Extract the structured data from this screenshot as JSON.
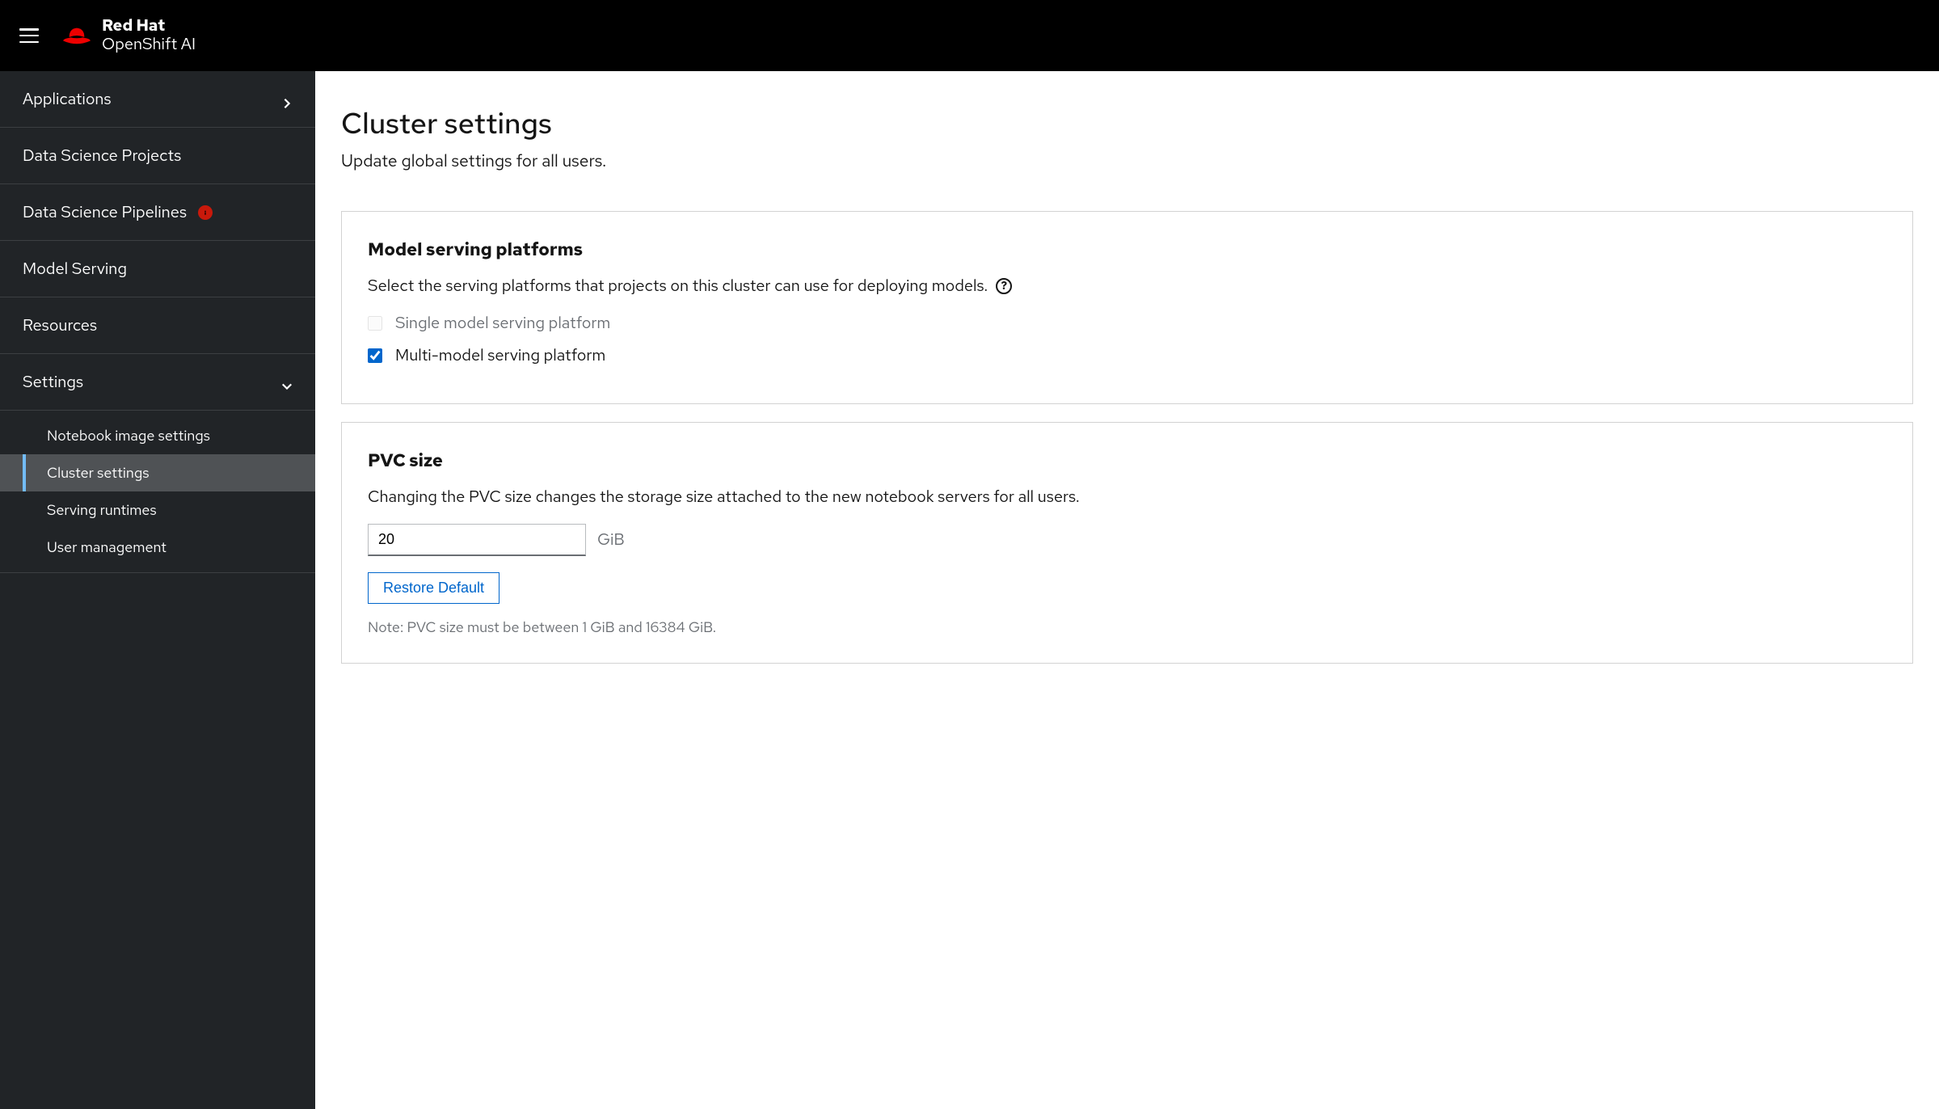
{
  "header": {
    "brand": "Red Hat",
    "product": "OpenShift AI"
  },
  "sidebar": {
    "items": [
      {
        "label": "Applications",
        "expandable": true,
        "expanded": false
      },
      {
        "label": "Data Science Projects"
      },
      {
        "label": "Data Science Pipelines",
        "alert": true
      },
      {
        "label": "Model Serving"
      },
      {
        "label": "Resources"
      },
      {
        "label": "Settings",
        "expandable": true,
        "expanded": true
      }
    ],
    "settings_sub": [
      {
        "label": "Notebook image settings"
      },
      {
        "label": "Cluster settings",
        "active": true
      },
      {
        "label": "Serving runtimes"
      },
      {
        "label": "User management"
      }
    ]
  },
  "page": {
    "title": "Cluster settings",
    "subtitle": "Update global settings for all users."
  },
  "model_serving": {
    "heading": "Model serving platforms",
    "description": "Select the serving platforms that projects on this cluster can use for deploying models.",
    "options": [
      {
        "label": "Single model serving platform",
        "checked": false,
        "disabled": true
      },
      {
        "label": "Multi-model serving platform",
        "checked": true,
        "disabled": false
      }
    ]
  },
  "pvc": {
    "heading": "PVC size",
    "description": "Changing the PVC size changes the storage size attached to the new notebook servers for all users.",
    "value": "20",
    "unit": "GiB",
    "restore_label": "Restore Default",
    "note": "Note: PVC size must be between 1 GiB and 16384 GiB."
  }
}
